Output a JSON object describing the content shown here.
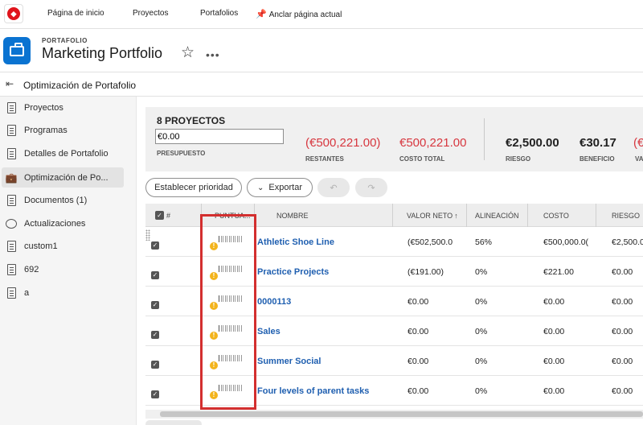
{
  "nav": {
    "logo": "shield-logo",
    "home": "Página de inicio",
    "projects": "Proyectos",
    "portfolios": "Portafolios",
    "pin": "Anclar página actual"
  },
  "header": {
    "kicker": "PORTAFOLIO",
    "title": "Marketing Portfolio"
  },
  "breadcrumb": {
    "title": "Optimización de Portafolio"
  },
  "sidebar": {
    "items": [
      {
        "label": "Proyectos",
        "icon": "projects-icon"
      },
      {
        "label": "Programas",
        "icon": "programs-icon"
      },
      {
        "label": "Detalles de Portafolio",
        "icon": "details-icon"
      },
      {
        "label": "Optimización de Po...",
        "icon": "optimizer-icon",
        "active": true
      },
      {
        "label": "Documentos (1)",
        "icon": "documents-icon"
      },
      {
        "label": "Actualizaciones",
        "icon": "updates-icon"
      },
      {
        "label": "custom1",
        "icon": "custom-page-icon"
      },
      {
        "label": "692",
        "icon": "custom-page-icon"
      },
      {
        "label": "a",
        "icon": "custom-page-icon"
      }
    ]
  },
  "summary": {
    "heading": "8 PROYECTOS",
    "budget_value": "€0.00",
    "budget_label": "PRESUPUESTO",
    "remaining_value": "(€500,221.00)",
    "remaining_label": "RESTANTES",
    "total_cost_value": "€500,221.00",
    "total_cost_label": "COSTO TOTAL",
    "risk_value": "€2,500.00",
    "risk_label": "RIESGO",
    "benefit_value": "€30.17",
    "benefit_label": "BENEFICIO",
    "partial_value": "(€",
    "partial_label": "VA"
  },
  "toolbar": {
    "prioritize": "Establecer prioridad",
    "export": "Exportar",
    "undo_icon": "undo-icon",
    "redo_icon": "redo-icon"
  },
  "table": {
    "headers": {
      "num": "#",
      "score": "PUNTUA...",
      "name": "NOMBRE",
      "net_value": "VALOR NETO",
      "alignment": "ALINEACIÓN",
      "cost": "COSTO",
      "risk": "RIESGO"
    },
    "rows": [
      {
        "name": "Athletic Shoe Line",
        "net_value": "(€502,500.0",
        "alignment": "56%",
        "cost": "€500,000.0(",
        "risk": "€2,500.0"
      },
      {
        "name": "Practice Projects",
        "net_value": "(€191.00)",
        "alignment": "0%",
        "cost": "€221.00",
        "risk": "€0.00"
      },
      {
        "name": "0000113",
        "net_value": "€0.00",
        "alignment": "0%",
        "cost": "€0.00",
        "risk": "€0.00"
      },
      {
        "name": "Sales",
        "net_value": "€0.00",
        "alignment": "0%",
        "cost": "€0.00",
        "risk": "€0.00"
      },
      {
        "name": "Summer Social",
        "net_value": "€0.00",
        "alignment": "0%",
        "cost": "€0.00",
        "risk": "€0.00"
      },
      {
        "name": "Four levels of parent tasks",
        "net_value": "€0.00",
        "alignment": "0%",
        "cost": "€0.00",
        "risk": "€0.00"
      }
    ]
  },
  "colors": {
    "accent": "#0a73d1",
    "negative": "#d7373f",
    "link": "#1f5fb0",
    "warning": "#f3b41c",
    "highlight": "#d32f2f"
  }
}
